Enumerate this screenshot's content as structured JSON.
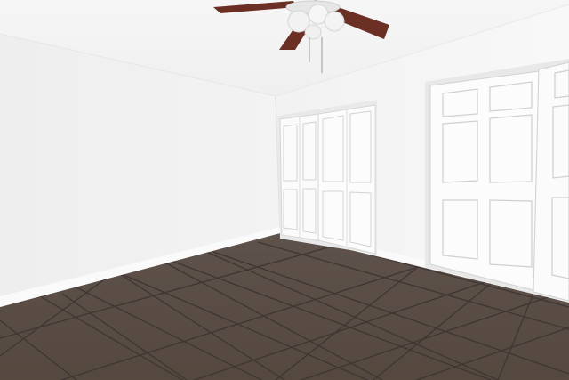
{
  "scene": {
    "description_free": true,
    "colors": {
      "ceiling": "#f4f4f4",
      "wall_left": "#f1f1f1",
      "wall_right": "#f6f6f6",
      "trim": "#fafafa",
      "door": "#fbfbfb",
      "door_panel_line": "#d8d8d8",
      "floor": "#5b4f49",
      "floor_light": "#6a5c55",
      "grout": "#3d3431",
      "fan_blade": "#6a2e22",
      "fan_body": "#e9e9e9"
    }
  }
}
